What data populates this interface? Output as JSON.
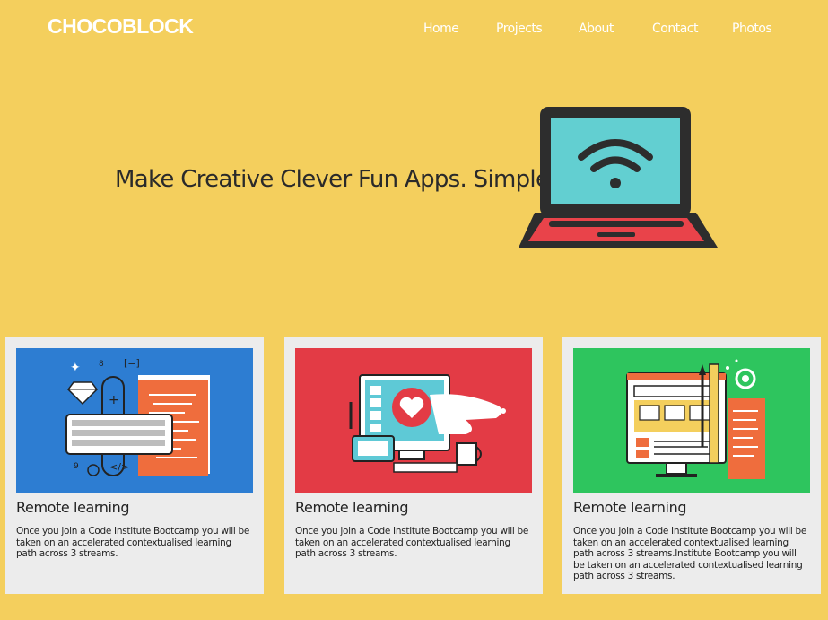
{
  "header": {
    "brand": "CHOCOBLOCK",
    "nav": [
      "Home",
      "Projects",
      "About",
      "Contact",
      "Photos"
    ]
  },
  "hero": {
    "headline": "Make Creative Clever Fun Apps. Simple.",
    "illustration": "laptop-wifi-icon"
  },
  "cards": [
    {
      "title": "Remote learning",
      "text": "Once you join a Code Institute Bootcamp you will be taken on an accelerated contextualised learning path across 3 streams.",
      "image": "keyboard-code-illustration",
      "color": "#2d7dd2"
    },
    {
      "title": "Remote learning",
      "text": "Once you join a Code Institute Bootcamp you will be taken on an accelerated contextualised learning path across 3 streams.",
      "image": "design-desktop-illustration",
      "color": "#e33b45"
    },
    {
      "title": "Remote learning",
      "text": "Once you join a Code Institute Bootcamp you will be taken on an accelerated contextualised learning path across 3 streams.Institute Bootcamp you will be taken on an accelerated contextualised learning path across 3 streams.",
      "image": "web-layout-illustration",
      "color": "#2ec55e"
    }
  ],
  "colors": {
    "background": "#f4cf5d",
    "card_background": "#ececec",
    "text": "#2a2a2a"
  }
}
